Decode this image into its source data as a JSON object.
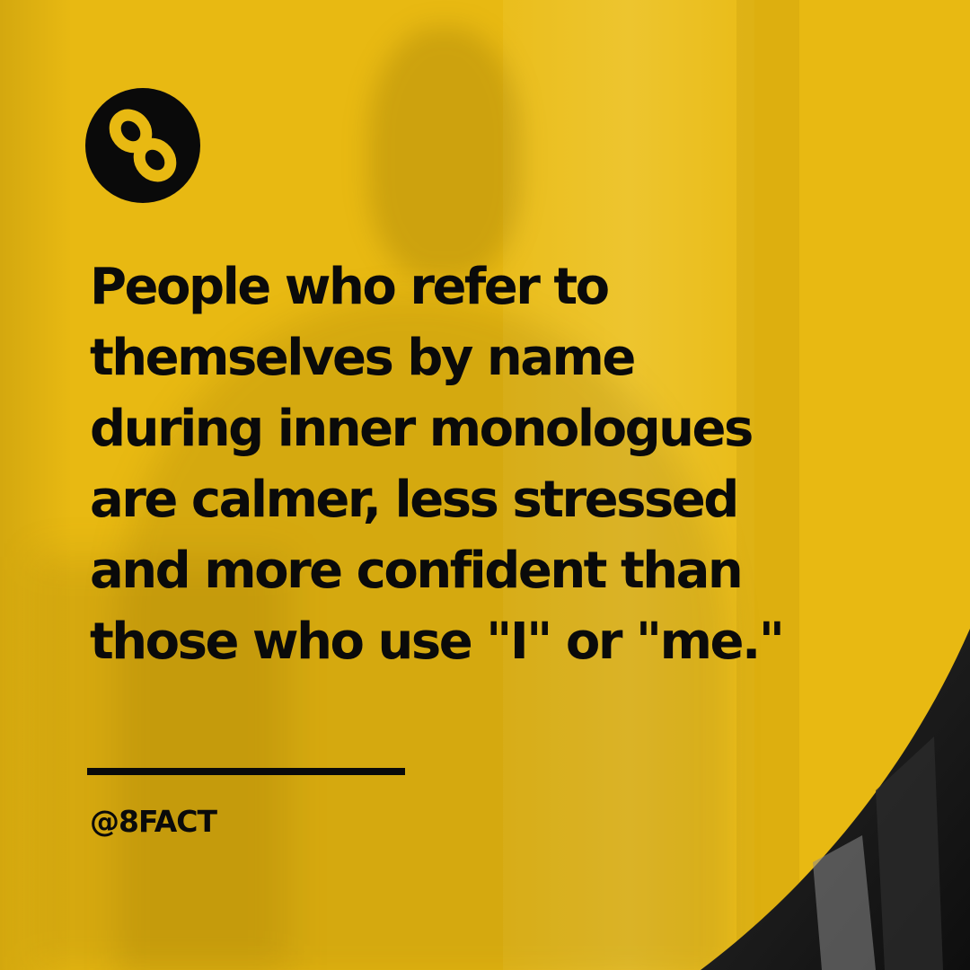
{
  "colors": {
    "background": "#e8b912",
    "text": "#0a0a0a",
    "corner_photo": "#1f1f1f"
  },
  "logo": {
    "icon": "infinity-eight-icon"
  },
  "headline": {
    "lines": [
      "People who refer to",
      "themselves by name",
      "during inner monologues",
      "are calmer, less stressed",
      "and more confident than",
      "those who use \"I\" or \"me.\""
    ]
  },
  "handle": "@8FACT"
}
